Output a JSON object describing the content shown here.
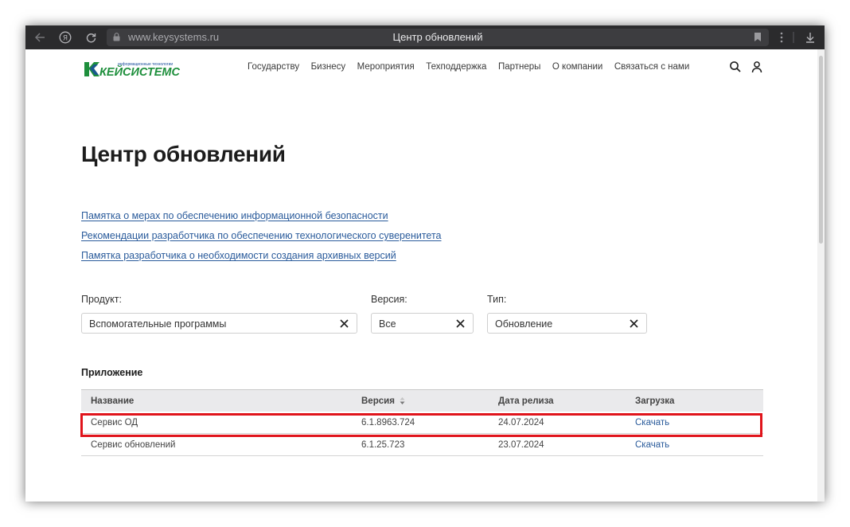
{
  "browser": {
    "url": "www.keysystems.ru",
    "title": "Центр обновлений"
  },
  "logo": {
    "tagline": "информационные технологии",
    "name": "КЕЙСИСТЕМС"
  },
  "nav": [
    "Государству",
    "Бизнесу",
    "Мероприятия",
    "Техподдержка",
    "Партнеры",
    "О компании",
    "Связаться с нами"
  ],
  "page": {
    "title": "Центр обновлений",
    "links": [
      "Памятка о мерах по обеспечению информационной безопасности",
      "Рекомендации разработчика по обеспечению технологического суверенитета",
      "Памятка разработчика о необходимости создания архивных версий"
    ]
  },
  "filters": {
    "product": {
      "label": "Продукт:",
      "value": "Вспомогательные программы"
    },
    "version": {
      "label": "Версия:",
      "value": "Все"
    },
    "type": {
      "label": "Тип:",
      "value": "Обновление"
    }
  },
  "section_title": "Приложение",
  "table": {
    "columns": [
      "Название",
      "Версия",
      "Дата релиза",
      "Загрузка"
    ],
    "rows": [
      {
        "name": "Сервис ОД",
        "version": "6.1.8963.724",
        "date": "24.07.2024",
        "download": "Скачать",
        "highlighted": true
      },
      {
        "name": "Сервис обновлений",
        "version": "6.1.25.723",
        "date": "23.07.2024",
        "download": "Скачать",
        "highlighted": false
      }
    ]
  },
  "colors": {
    "link": "#2a5b9b",
    "highlight": "#e0141b",
    "logo_green": "#1e8f3c",
    "logo_blue": "#1b4f9c"
  },
  "icons": {
    "back": "arrow-left-icon",
    "yandex": "yandex-icon",
    "reload": "reload-icon",
    "lock": "lock-icon",
    "bookmark": "bookmark-icon",
    "menu": "kebab-menu-icon",
    "download": "download-icon",
    "search": "search-icon",
    "user": "user-icon",
    "clear": "close-icon",
    "sort": "sort-icon"
  }
}
